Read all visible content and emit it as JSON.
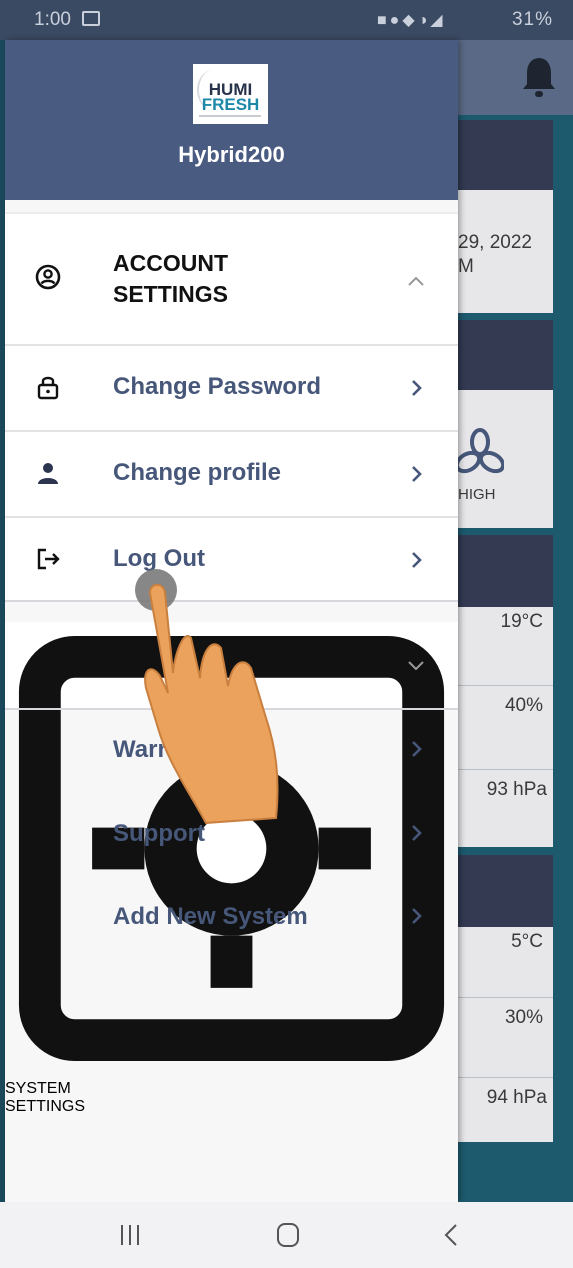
{
  "status_bar": {
    "time": "1:00",
    "battery": "31%"
  },
  "drawer": {
    "logo_line1": "HUMI",
    "logo_line2": "FRESH",
    "system_name": "Hybrid200",
    "sections": {
      "account": {
        "label_line1": "ACCOUNT",
        "label_line2": "SETTINGS",
        "expanded": true
      },
      "system": {
        "label_line1": "SYSTEM",
        "label_line2": "SETTINGS",
        "expanded": false
      }
    },
    "items": {
      "change_password": "Change Password",
      "change_profile": "Change profile",
      "log_out": "Log Out",
      "warranty": "Warranty",
      "support": "Support",
      "add_system": "Add New System"
    }
  },
  "background": {
    "date_line1": "29, 2022",
    "date_line2": "M",
    "fan_speed": "HIGH",
    "indoor": {
      "temp": "19°C",
      "humidity": "40%",
      "pressure": "93 hPa"
    },
    "outdoor": {
      "temp": "5°C",
      "humidity": "30%",
      "pressure": "94 hPa"
    }
  },
  "colors": {
    "header": "#4a5b82",
    "item_text": "#46577a",
    "accent_dark": "#333a52"
  }
}
